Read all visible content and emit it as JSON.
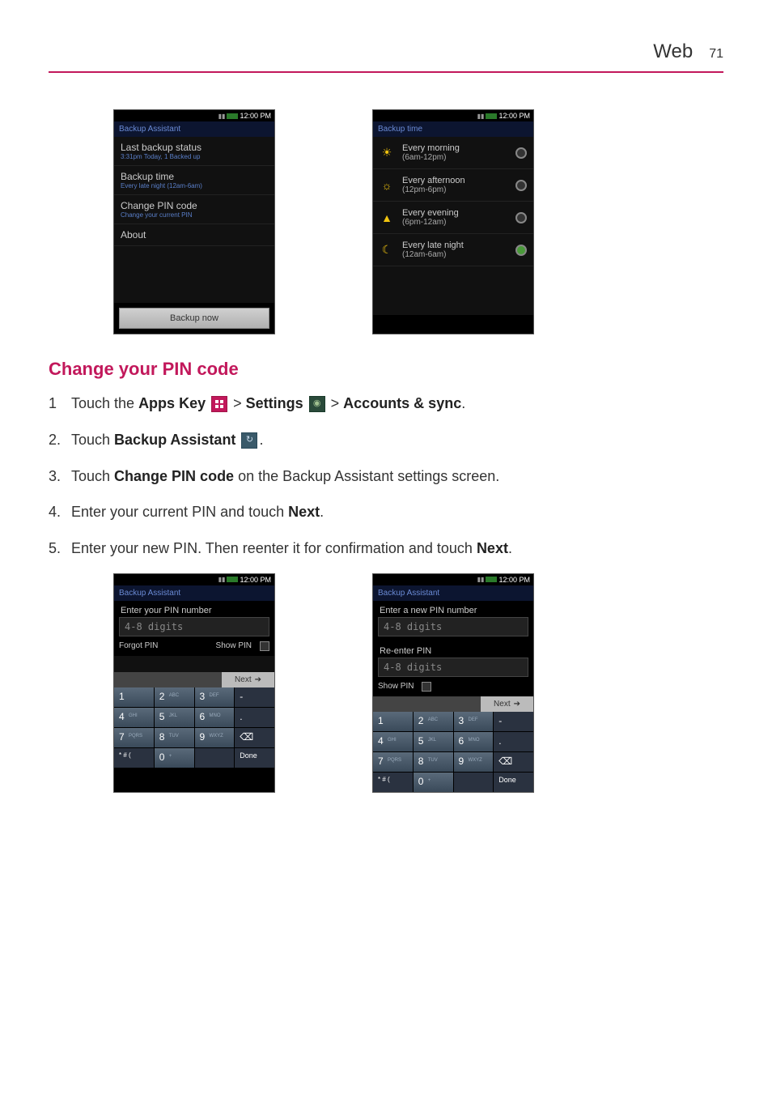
{
  "header": {
    "section": "Web",
    "page": "71"
  },
  "screen1": {
    "clock": "12:00 PM",
    "title": "Backup Assistant",
    "items": [
      {
        "title": "Last backup status",
        "sub": "3:31pm Today, 1 Backed up"
      },
      {
        "title": "Backup time",
        "sub": "Every late night (12am-6am)"
      },
      {
        "title": "Change PIN code",
        "sub": "Change your current PIN"
      },
      {
        "title": "About",
        "sub": ""
      }
    ],
    "button": "Backup now"
  },
  "screen2": {
    "clock": "12:00 PM",
    "title": "Backup time",
    "options": [
      {
        "icon": "☀",
        "top": "Every morning",
        "sub": "(6am-12pm)",
        "selected": false
      },
      {
        "icon": "☼",
        "top": "Every afternoon",
        "sub": "(12pm-6pm)",
        "selected": false
      },
      {
        "icon": "▲",
        "top": "Every evening",
        "sub": "(6pm-12am)",
        "selected": false
      },
      {
        "icon": "☾",
        "top": "Every late night",
        "sub": "(12am-6am)",
        "selected": true
      }
    ]
  },
  "heading": "Change your PIN code",
  "steps": {
    "s1a": "Touch the ",
    "s1_apps": "Apps Key",
    "s1_gt1": " > ",
    "s1_settings": "Settings",
    "s1_gt2": " > ",
    "s1_accounts": "Accounts & sync",
    "s1_end": ".",
    "s2a": "Touch ",
    "s2_ba": "Backup Assistant",
    "s2_end": ".",
    "s3a": "Touch ",
    "s3_cpc": "Change PIN code",
    "s3b": " on the Backup Assistant settings screen.",
    "s4a": "Enter your current PIN and touch ",
    "s4_next": "Next",
    "s4_end": ".",
    "s5a": "Enter your new PIN. Then reenter it for confirmation and touch ",
    "s5_next": "Next",
    "s5_end": "."
  },
  "screen3": {
    "clock": "12:00 PM",
    "title": "Backup Assistant",
    "label": "Enter your PIN number",
    "placeholder": "4-8 digits",
    "forgot": "Forgot PIN",
    "show": "Show PIN",
    "next": "Next"
  },
  "screen4": {
    "clock": "12:00 PM",
    "title": "Backup Assistant",
    "label1": "Enter a new PIN number",
    "placeholder1": "4-8 digits",
    "label2": "Re-enter PIN",
    "placeholder2": "4-8 digits",
    "show": "Show PIN",
    "next": "Next"
  },
  "keypad": {
    "keys": [
      {
        "d": "1",
        "s": ""
      },
      {
        "d": "2",
        "s": "ABC"
      },
      {
        "d": "3",
        "s": "DEF"
      },
      {
        "d": "-",
        "s": ""
      },
      {
        "d": "4",
        "s": "GHI"
      },
      {
        "d": "5",
        "s": "JKL"
      },
      {
        "d": "6",
        "s": "MNO"
      },
      {
        "d": ".",
        "s": ""
      },
      {
        "d": "7",
        "s": "PQRS"
      },
      {
        "d": "8",
        "s": "TUV"
      },
      {
        "d": "9",
        "s": "WXYZ"
      },
      {
        "d": "⌫",
        "s": ""
      },
      {
        "d": "* # (",
        "s": ""
      },
      {
        "d": "0",
        "s": "+"
      },
      {
        "d": "",
        "s": ""
      },
      {
        "d": "Done",
        "s": ""
      }
    ]
  }
}
